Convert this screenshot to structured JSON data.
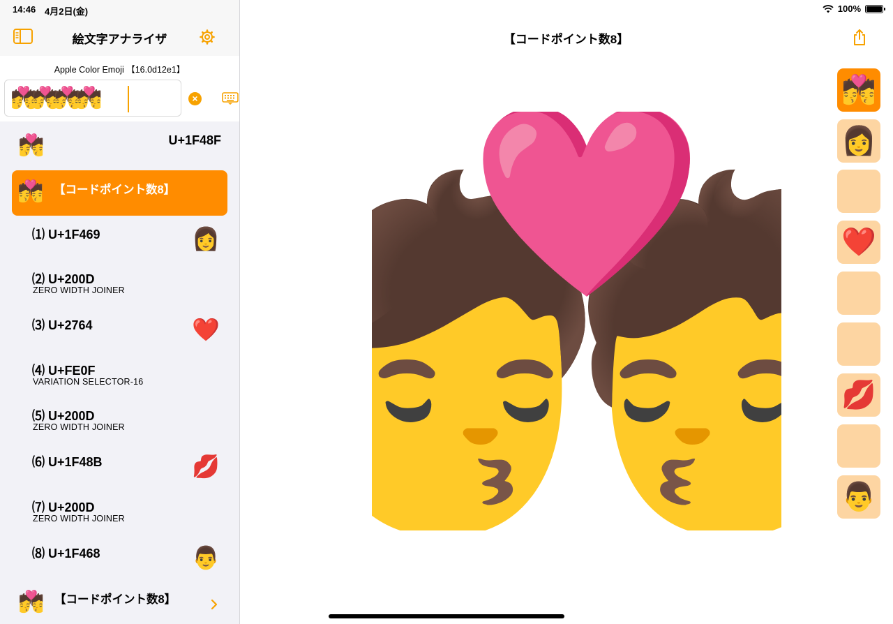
{
  "status": {
    "time": "14:46",
    "date": "4月2日(金)",
    "battery": "100%",
    "battery_level": 1.0
  },
  "sidebar": {
    "title": "絵文字アナライザ",
    "font_label": "Apple Color Emoji 【16.0d12e1】",
    "input_value": "💏💏💏💏",
    "top_item": {
      "emoji": "💏",
      "code": "U+1F48F"
    },
    "selected_item": {
      "emoji": "💏",
      "label": "【コードポイント数8】"
    },
    "codepoints": [
      {
        "index": "⑴",
        "code": "U+1F469",
        "desc": "",
        "emoji": "👩"
      },
      {
        "index": "⑵",
        "code": "U+200D",
        "desc": "ZERO WIDTH JOINER",
        "emoji": ""
      },
      {
        "index": "⑶",
        "code": "U+2764",
        "desc": "",
        "emoji": "❤️"
      },
      {
        "index": "⑷",
        "code": "U+FE0F",
        "desc": "VARIATION SELECTOR-16",
        "emoji": ""
      },
      {
        "index": "⑸",
        "code": "U+200D",
        "desc": "ZERO WIDTH JOINER",
        "emoji": ""
      },
      {
        "index": "⑹",
        "code": "U+1F48B",
        "desc": "",
        "emoji": "💋"
      },
      {
        "index": "⑺",
        "code": "U+200D",
        "desc": "ZERO WIDTH JOINER",
        "emoji": ""
      },
      {
        "index": "⑻",
        "code": "U+1F468",
        "desc": "",
        "emoji": "👨"
      }
    ],
    "bottom_item": {
      "emoji": "💏",
      "label": "【コードポイント数8】"
    }
  },
  "main": {
    "title": "【コードポイント数8】",
    "preview_emoji": "💏"
  },
  "strip": [
    "💏",
    "👩",
    "",
    "❤️",
    "",
    "",
    "💋",
    "",
    "👨"
  ],
  "icons": {
    "sidebar_toggle": "sidebar-icon",
    "settings": "gear-icon",
    "clear": "clear-icon",
    "keyboard": "keyboard-icon",
    "share": "share-icon",
    "chevron": "chevron-right-icon"
  },
  "colors": {
    "accent": "#f7a200",
    "selected": "#ff8c00",
    "tile": "#fdd5a2"
  }
}
